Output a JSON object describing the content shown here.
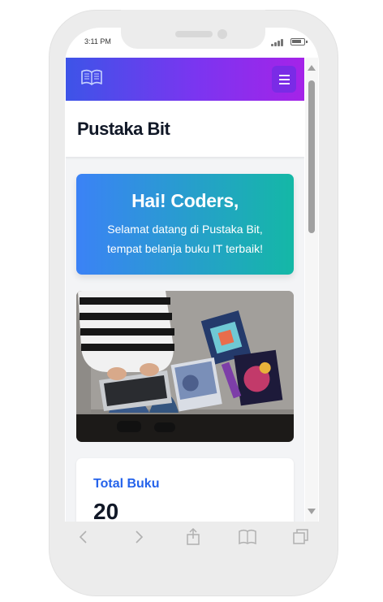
{
  "status_bar": {
    "time": "3:11 PM"
  },
  "navbar": {
    "logo_icon": "open-book-icon",
    "menu_icon": "hamburger-icon"
  },
  "header": {
    "title": "Pustaka Bit"
  },
  "hero": {
    "title": "Hai! Coders,",
    "subtitle_line1": "Selamat datang di Pustaka Bit,",
    "subtitle_line2": "tempat belanja buku IT terbaik!"
  },
  "photo": {
    "subject": "person-with-laptop-and-books"
  },
  "stats": {
    "label": "Total Buku",
    "value": "20"
  },
  "browser_toolbar": {
    "icons": [
      "back-icon",
      "forward-icon",
      "share-icon",
      "bookmarks-icon",
      "tabs-icon"
    ]
  },
  "colors": {
    "navbar_start": "#3d54e8",
    "navbar_end": "#a523e8",
    "hero_start": "#3b82f6",
    "hero_end": "#14b8a6",
    "stat_label": "#2563eb"
  }
}
